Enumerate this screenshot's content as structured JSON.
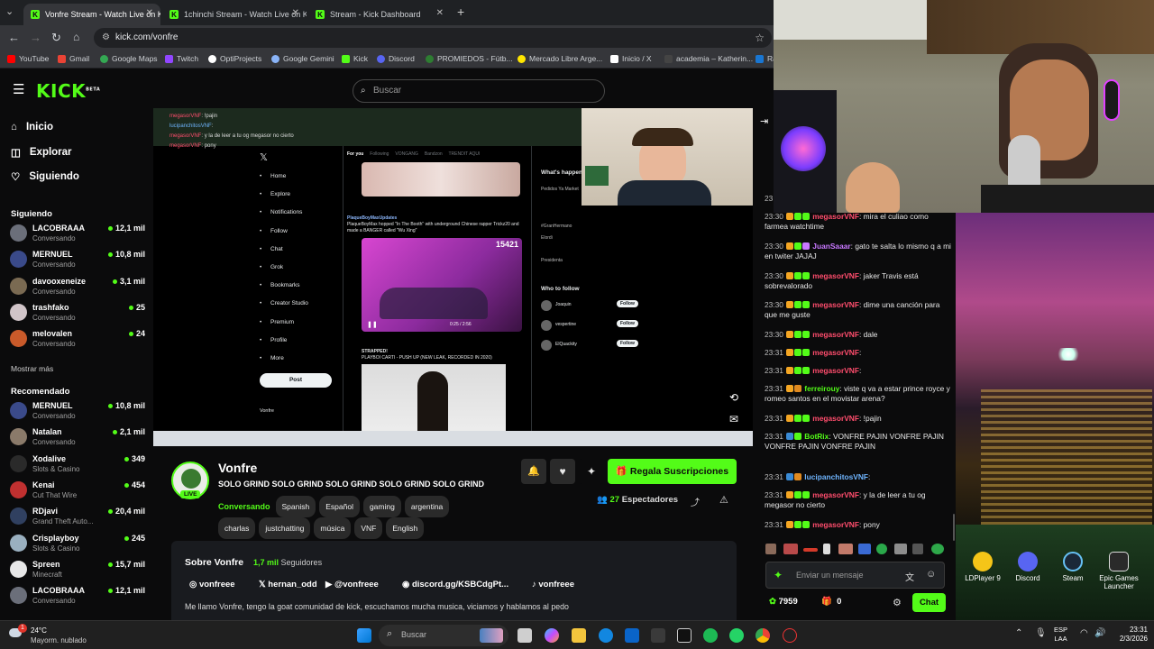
{
  "browser": {
    "tabs": [
      {
        "title": "Vonfre Stream - Watch Live on Kick",
        "active": true
      },
      {
        "title": "1chinchi Stream - Watch Live on Kick",
        "active": false
      },
      {
        "title": "Stream - Kick Dashboard",
        "active": false
      }
    ],
    "new_tab": "+",
    "url": "kick.com/vonfre",
    "bookmarks": [
      "YouTube",
      "Gmail",
      "Google Maps",
      "Twitch",
      "OptiProjects",
      "Google Gemini",
      "Kick",
      "Discord",
      "PROMIEDOS - Fútb...",
      "Mercado Libre Arge...",
      "Inicio / X",
      "academia – Katherin...",
      "Ra"
    ]
  },
  "header": {
    "logo": "KICK",
    "logo_sup": "BETA",
    "search_placeholder": "Buscar"
  },
  "sidebar": {
    "nav": [
      {
        "label": "Inicio",
        "icon": "home-icon"
      },
      {
        "label": "Explorar",
        "icon": "compass-icon"
      },
      {
        "label": "Siguiendo",
        "icon": "heart-icon"
      }
    ],
    "following_title": "Siguiendo",
    "following": [
      {
        "name": "LACOBRAAA",
        "category": "Conversando",
        "viewers": "12,1 mil",
        "color": "#6b6f7a"
      },
      {
        "name": "MERNUEL",
        "category": "Conversando",
        "viewers": "10,8 mil",
        "color": "#3a4a8a"
      },
      {
        "name": "davooxeneize",
        "category": "Conversando",
        "viewers": "3,1 mil",
        "color": "#7a6a52"
      },
      {
        "name": "trashfako",
        "category": "Conversando",
        "viewers": "25",
        "color": "#d0c4c8"
      },
      {
        "name": "melovalen",
        "category": "Conversando",
        "viewers": "24",
        "color": "#c95a2a"
      }
    ],
    "show_more": "Mostrar más",
    "recommended_title": "Recomendado",
    "recommended": [
      {
        "name": "MERNUEL",
        "category": "Conversando",
        "viewers": "10,8 mil",
        "color": "#3a4a8a"
      },
      {
        "name": "Natalan",
        "category": "Conversando",
        "viewers": "2,1 mil",
        "color": "#8a7a6a"
      },
      {
        "name": "Xodalive",
        "category": "Slots & Casino",
        "viewers": "349",
        "color": "#2a2a2a"
      },
      {
        "name": "Kenai",
        "category": "Cut That Wire",
        "viewers": "454",
        "color": "#c03030"
      },
      {
        "name": "RDjavi",
        "category": "Grand Theft Auto...",
        "viewers": "20,4 mil",
        "color": "#304060"
      },
      {
        "name": "Crisplayboy",
        "category": "Slots & Casino",
        "viewers": "245",
        "color": "#9ab0c0"
      },
      {
        "name": "Spreen",
        "category": "Minecraft",
        "viewers": "15,7 mil",
        "color": "#e8e8e8"
      },
      {
        "name": "LACOBRAAA",
        "category": "Conversando",
        "viewers": "12,1 mil",
        "color": "#6b6f7a"
      }
    ]
  },
  "stream": {
    "inner_chat": [
      {
        "user": "megasorVNF",
        "text": "!pajin"
      },
      {
        "user": "lucipanchitosVNF",
        "text": ""
      },
      {
        "user": "megasorVNF",
        "text": "y la de leer a tu og megasor no cierto"
      },
      {
        "user": "megasorVNF",
        "text": "pony"
      }
    ],
    "x_nav": [
      "Home",
      "Explore",
      "Notifications",
      "Follow",
      "Chat",
      "Grok",
      "Bookmarks",
      "Creator Studio",
      "Premium",
      "Profile",
      "More"
    ],
    "x_post_button": "Post",
    "x_tabs": [
      "For you",
      "Following",
      "VONGANG",
      "Bandzon",
      "TRENDIT AQUI"
    ],
    "x_post1_author": "PlaqueBoyMaxUpdates",
    "x_post1_text": "PlaqueBoyMax hopped \"In The Booth\" with underground Chinese rapper Trickz20 and made a BANGER called \"Wu Xing\"",
    "x_video_counter": "15421",
    "x_video_time": "0:25 / 2:56",
    "x_post2_text": "PLAYBOI CARTI - PUSH UP (NEW LEAK, RECORDED IN 2020)",
    "x_post2_author": "STRAPPED!",
    "whats_happening": "What's happening",
    "who_to_follow": "Who to follow",
    "follow_label": "Follow",
    "follow_suggestions": [
      "Joaquin",
      "vespertine",
      "ElQuackity"
    ],
    "trend_items": [
      "Pedidos Ya Market",
      "#GranHermano",
      "Elordi",
      "Presidenta"
    ],
    "profile_name": "Vonfre"
  },
  "channel": {
    "name": "Vonfre",
    "live_badge": "LIVE",
    "title": "SOLO GRIND SOLO GRIND SOLO GRIND SOLO GRIND SOLO GRIND",
    "category": "Conversando",
    "tags": [
      "Spanish",
      "Español",
      "gaming",
      "argentina",
      "charlas",
      "justchatting",
      "música",
      "VNF",
      "English"
    ],
    "subscribe_button": "Regala Suscripciones",
    "viewers_count": "27",
    "viewers_label": "Espectadores",
    "about_title": "Sobre Vonfre",
    "followers_count": "1,7 mil",
    "followers_label": "Seguidores",
    "socials": [
      {
        "icon": "instagram-icon",
        "label": "vonfreee"
      },
      {
        "icon": "x-icon",
        "label": "hernan_odd"
      },
      {
        "icon": "youtube-icon",
        "label": "@vonfreee"
      },
      {
        "icon": "discord-icon",
        "label": "discord.gg/KSBCdgPt..."
      },
      {
        "icon": "tiktok-icon",
        "label": "vonfreee"
      }
    ],
    "bio": "Me llamo Vonfre, tengo la goat comunidad de kick, escuchamos mucha musica, viciamos y hablamos al pedo"
  },
  "chat": {
    "partial_time": "23:",
    "messages": [
      {
        "time": "23:30",
        "user": "megasorVNF",
        "color": "#ff4d6d",
        "text": "mira el culiao como farmea watchtime"
      },
      {
        "time": "23:30",
        "user": "JuanSaaar",
        "color": "#c878ff",
        "text": "gato te salta lo mismo q a mi en twiter JAJAJ"
      },
      {
        "time": "23:30",
        "user": "megasorVNF",
        "color": "#ff4d6d",
        "text": "jaker Travis está sobrevalorado"
      },
      {
        "time": "23:30",
        "user": "megasorVNF",
        "color": "#ff4d6d",
        "text": "dime una canción para que me guste"
      },
      {
        "time": "23:30",
        "user": "megasorVNF",
        "color": "#ff4d6d",
        "text": "dale"
      },
      {
        "time": "23:31",
        "user": "megasorVNF",
        "color": "#ff4d6d",
        "text": ""
      },
      {
        "time": "23:31",
        "user": "megasorVNF",
        "color": "#ff4d6d",
        "text": ""
      },
      {
        "time": "23:31",
        "user": "ferreirouy",
        "color": "#53fc18",
        "text": "viste q va a estar prince royce y romeo santos en el movistar arena?"
      },
      {
        "time": "23:31",
        "user": "megasorVNF",
        "color": "#ff4d6d",
        "text": "!pajin"
      },
      {
        "time": "23:31",
        "user": "BotRix",
        "color": "#53fc18",
        "text": "VONFRE PAJIN VONFRE PAJIN VONFRE PAJIN VONFRE PAJIN"
      },
      {
        "time": "23:31",
        "user": "lucipanchitosVNF",
        "color": "#6fb5ff",
        "text": ""
      },
      {
        "time": "23:31",
        "user": "megasorVNF",
        "color": "#ff4d6d",
        "text": "y la de leer a tu og megasor no cierto"
      },
      {
        "time": "23:31",
        "user": "megasorVNF",
        "color": "#ff4d6d",
        "text": "pony"
      }
    ],
    "input_placeholder": "Enviar un mensaje",
    "points": "7959",
    "gifts": "0",
    "send_button": "Chat"
  },
  "desktop": {
    "icons": [
      "LDPlayer 9",
      "Discord",
      "Steam",
      "Epic Games Launcher"
    ]
  },
  "taskbar": {
    "weather_temp": "24°C",
    "weather_desc": "Mayorm. nublado",
    "weather_badge": "1",
    "search_placeholder": "Buscar",
    "lang": "ESP",
    "lang_sub": "LAA",
    "time": "23:31",
    "date": "2/3/2026"
  }
}
